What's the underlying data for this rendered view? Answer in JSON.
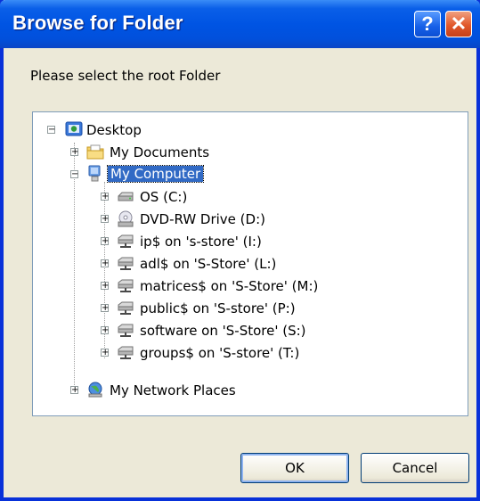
{
  "window": {
    "title": "Browse for Folder",
    "help_glyph": "?",
    "close_glyph": "✕"
  },
  "prompt": "Please select the root Folder",
  "tree": {
    "desktop": "Desktop",
    "my_documents": "My Documents",
    "my_computer": "My Computer",
    "drives": [
      "OS (C:)",
      "DVD-RW Drive (D:)",
      "ip$ on 's-store' (I:)",
      "adl$ on 'S-Store' (L:)",
      "matrices$ on 'S-Store' (M:)",
      "public$ on 'S-store' (P:)",
      "software on 'S-Store' (S:)",
      "groups$ on 'S-store' (T:)"
    ],
    "network": "My Network Places",
    "expand_plus": "+",
    "expand_minus": "−"
  },
  "buttons": {
    "ok": "OK",
    "cancel": "Cancel"
  },
  "colors": {
    "titlebar": "#0054e3",
    "selection": "#316ac5",
    "dialog_bg": "#ece9d8"
  }
}
